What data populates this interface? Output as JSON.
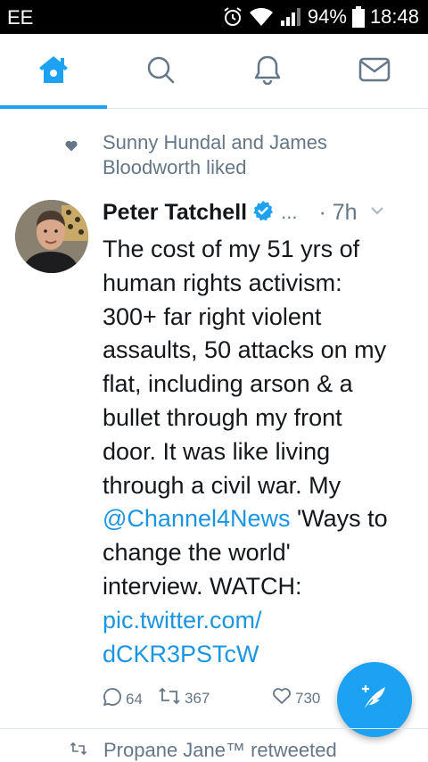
{
  "status_bar": {
    "carrier": "EE",
    "battery": "94%",
    "time": "18:48"
  },
  "tabs": [
    {
      "name": "home",
      "icon": "home-icon",
      "active": true
    },
    {
      "name": "search",
      "icon": "search-icon",
      "active": false
    },
    {
      "name": "notifications",
      "icon": "bell-icon",
      "active": false
    },
    {
      "name": "messages",
      "icon": "envelope-icon",
      "active": false
    }
  ],
  "tweet": {
    "social_context": [
      "Sunny Hundal and James",
      "Bloodworth liked"
    ],
    "author_name": "Peter Tatchell",
    "verified": true,
    "truncation": "...",
    "timestamp": "· 7h",
    "lines": [
      "The cost of my 51 yrs of",
      "human rights activism:",
      "300+ far right violent",
      "assaults, 50 attacks on my",
      "flat, including arson & a",
      "bullet through my front",
      "door. It was like living",
      "through a civil war. My"
    ],
    "mention": "@Channel4News",
    "after_mention": " 'Ways to",
    "lines_2": [
      "change the world'",
      "interview. WATCH:"
    ],
    "link_lines": [
      "pic.twitter.com/",
      "dCKR3PSTcW"
    ],
    "replies": "64",
    "retweets": "367",
    "likes": "730"
  },
  "next_tweet": {
    "social_context": "Propane Jane™ retweeted"
  },
  "colors": {
    "accent": "#1da1f2",
    "link": "#1b95e0",
    "secondary_text": "#657786"
  }
}
